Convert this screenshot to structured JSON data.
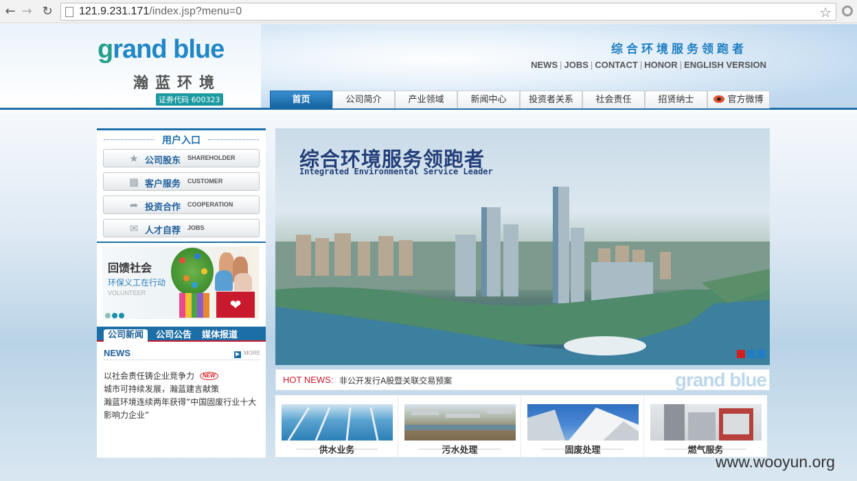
{
  "browser": {
    "url_host": "121.9.231.171",
    "url_path": "/index.jsp?menu=0"
  },
  "logo": {
    "en_prefix": "g",
    "en_rest": "rand blue",
    "cn": "瀚蓝环境",
    "stock": "证券代码 600323"
  },
  "slogan": "综合环境服务领跑者",
  "toplinks": [
    "NEWS",
    "JOBS",
    "CONTACT",
    "HONOR",
    "ENGLISH VERSION"
  ],
  "nav": [
    "首页",
    "公司简介",
    "产业领域",
    "新闻中心",
    "投资者关系",
    "社会责任",
    "招贤纳士",
    "官方微博"
  ],
  "user_entry": {
    "title": "用户入口",
    "items": [
      {
        "cn": "公司股东",
        "en": "SHAREHOLDER",
        "icon": "star-icon"
      },
      {
        "cn": "客户服务",
        "en": "CUSTOMER",
        "icon": "grid-icon"
      },
      {
        "cn": "投资合作",
        "en": "COOPERATION",
        "icon": "cursor-icon"
      },
      {
        "cn": "人才自荐",
        "en": "JOBS",
        "icon": "envelope-icon"
      }
    ]
  },
  "volunteer_banner": {
    "title": "回馈社会",
    "subtitle": "环保义工在行动",
    "en": "VOLUNTEER"
  },
  "news_tabs": [
    "公司新闻",
    "公司公告",
    "媒体报道"
  ],
  "news": {
    "heading": "NEWS",
    "more": "MORE",
    "new_badge": "NEW",
    "items": [
      "以社会责任铸企业竞争力",
      "城市可持续发展，瀚蓝建言献策",
      "瀚蓝环境连续两年获得”中国固废行业十大影响力企业”"
    ]
  },
  "hero": {
    "title": "综合环境服务领跑者",
    "subtitle": "Integrated Environmental Service Leader"
  },
  "hot_news": {
    "label": "HOT NEWS:",
    "text": "非公开发行A股暨关联交易预案",
    "logo": "grand blue"
  },
  "business": [
    "供水业务",
    "污水处理",
    "固废处理",
    "燃气服务"
  ],
  "watermark": "www.wooyun.org"
}
